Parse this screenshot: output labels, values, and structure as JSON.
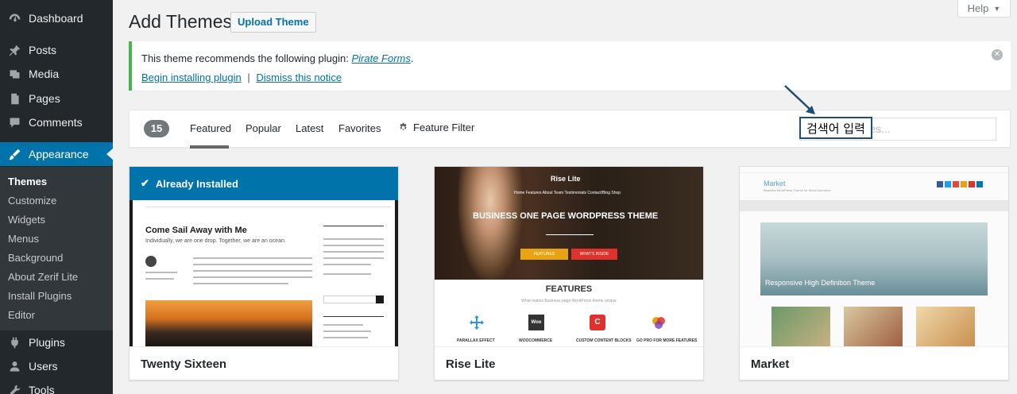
{
  "sidebar": {
    "items": [
      {
        "label": "Dashboard",
        "icon": "dashboard-icon"
      },
      {
        "label": "Posts",
        "icon": "pin-icon"
      },
      {
        "label": "Media",
        "icon": "media-icon"
      },
      {
        "label": "Pages",
        "icon": "pages-icon"
      },
      {
        "label": "Comments",
        "icon": "comment-icon"
      },
      {
        "label": "Appearance",
        "icon": "brush-icon"
      },
      {
        "label": "Plugins",
        "icon": "plugin-icon"
      },
      {
        "label": "Users",
        "icon": "users-icon"
      },
      {
        "label": "Tools",
        "icon": "tools-icon"
      }
    ],
    "submenu": [
      "Themes",
      "Customize",
      "Widgets",
      "Menus",
      "Background",
      "About Zerif Lite",
      "Install Plugins",
      "Editor"
    ],
    "accent": "#0073aa"
  },
  "header": {
    "title": "Add Themes",
    "upload_label": "Upload Theme",
    "help_label": "Help"
  },
  "notice": {
    "text": "This theme recommends the following plugin: ",
    "plugin": "Pirate Forms",
    "begin_link": "Begin installing plugin",
    "separator": "|",
    "dismiss_link": "Dismiss this notice",
    "border_color": "#46b450"
  },
  "filter": {
    "count": "15",
    "tabs": [
      "Featured",
      "Popular",
      "Latest",
      "Favorites"
    ],
    "feature_filter": "Feature Filter",
    "search_placeholder": "Search themes...",
    "annotation": "검색어 입력"
  },
  "themes": [
    {
      "name": "Twenty Sixteen",
      "installed_label": "Already Installed",
      "preview_title": "Come Sail Away with Me",
      "preview_sub": "Individually, we are one drop. Together, we are an ocean."
    },
    {
      "name": "Rise Lite",
      "preview_logo": "Rise Lite",
      "preview_nav": "Home  Features  About  Team  Testimonials  Contact/Blog  Shop",
      "preview_headline": "BUSINESS ONE PAGE WORDPRESS THEME",
      "preview_btn1": "FEATURES",
      "preview_btn2": "WHAT'S INSIDE",
      "preview_features": "FEATURES",
      "preview_features_sub": "What makes Business page WordPress theme unique",
      "preview_feature_labels": [
        "PARALLAX EFFECT",
        "WOOCOMMERCE",
        "CUSTOM CONTENT BLOCKS",
        "GO PRO FOR MORE FEATURES"
      ]
    },
    {
      "name": "Market",
      "preview_logo": "Market",
      "preview_tag": "Beautiful WordPress Theme for WooCommerce",
      "preview_hero": "Responsive High Definition Theme"
    }
  ]
}
